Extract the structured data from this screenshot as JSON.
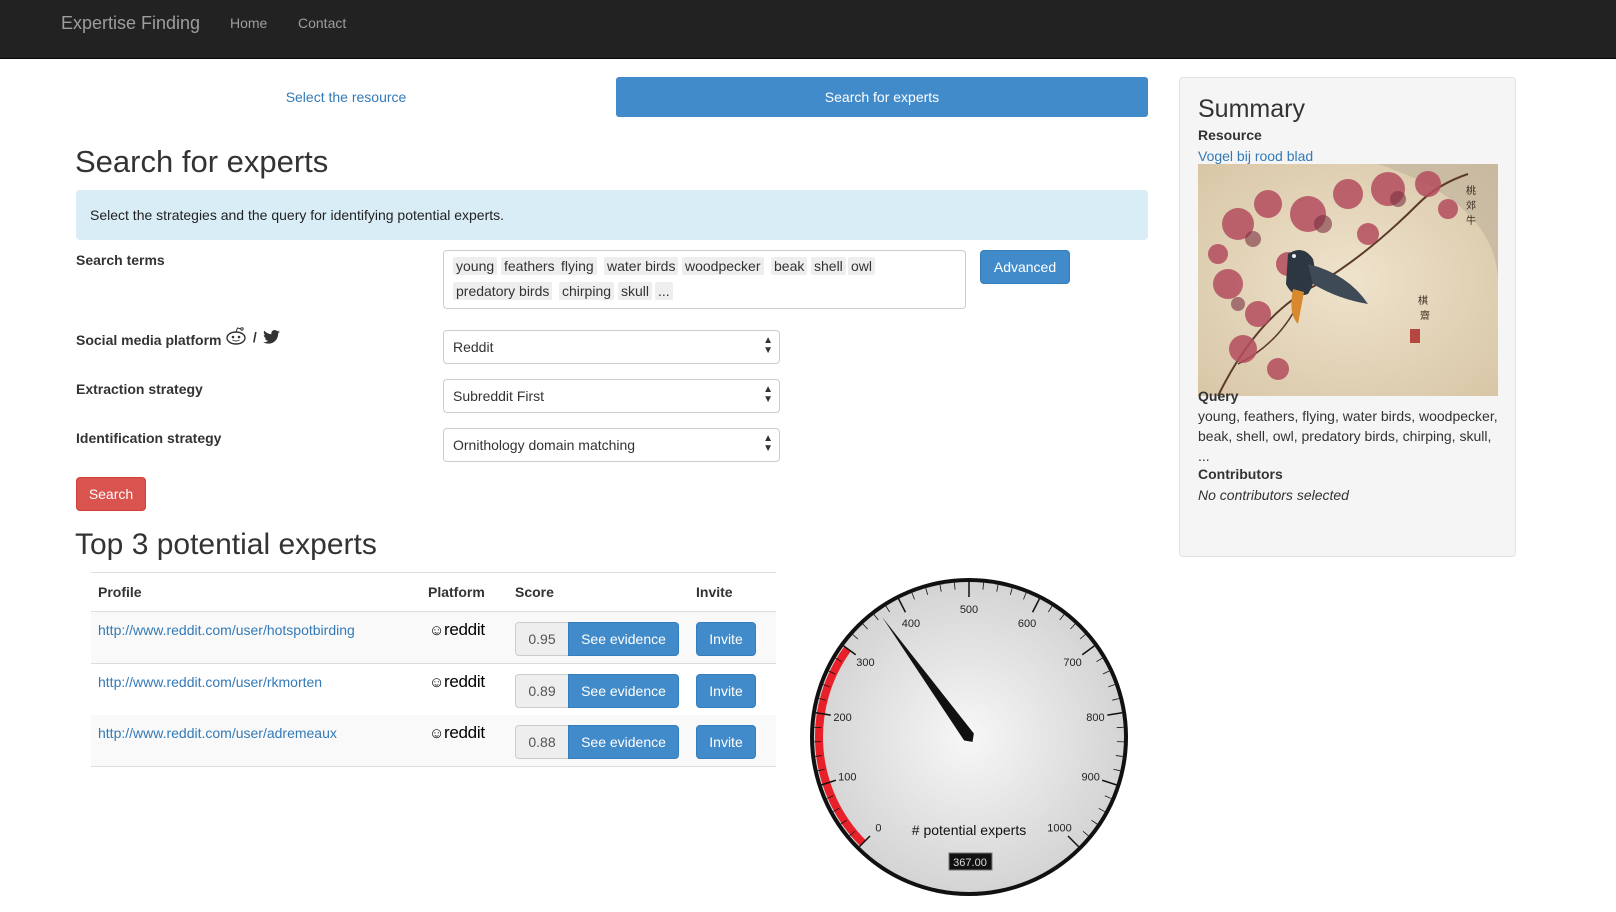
{
  "navbar": {
    "brand": "Expertise Finding",
    "links": [
      "Home",
      "Contact"
    ]
  },
  "steps": {
    "select_resource": "Select the resource",
    "search_experts": "Search for experts"
  },
  "main": {
    "title": "Search for experts",
    "info": "Select the strategies and the query for identifying potential experts."
  },
  "form": {
    "search_terms_label": "Search terms",
    "search_terms": [
      "young",
      "feathers",
      "flying",
      "water birds",
      "woodpecker",
      "beak",
      "shell",
      "owl",
      "predatory birds",
      "chirping",
      "skull",
      "..."
    ],
    "advanced_label": "Advanced",
    "platform_label": "Social media platform",
    "platform_separator": "/",
    "platform_value": "Reddit",
    "extraction_label": "Extraction strategy",
    "extraction_value": "Subreddit First",
    "identification_label": "Identification strategy",
    "identification_value": "Ornithology domain matching",
    "search_button": "Search"
  },
  "results": {
    "title": "Top 3 potential experts",
    "headers": {
      "profile": "Profile",
      "platform": "Platform",
      "score": "Score",
      "invite": "Invite"
    },
    "platform_name": "reddit",
    "evidence_label": "See evidence",
    "invite_label": "Invite",
    "rows": [
      {
        "profile": "http://www.reddit.com/user/hotspotbirding",
        "score": "0.95"
      },
      {
        "profile": "http://www.reddit.com/user/rkmorten",
        "score": "0.89"
      },
      {
        "profile": "http://www.reddit.com/user/adremeaux",
        "score": "0.88"
      }
    ]
  },
  "summary": {
    "title": "Summary",
    "resource_label": "Resource",
    "resource_link": "Vogel bij rood blad",
    "query_label": "Query",
    "query_text": "young, feathers, flying, water birds, woodpecker, beak, shell, owl, predatory birds, chirping, skull, ...",
    "contributors_label": "Contributors",
    "contributors_text": "No contributors selected"
  },
  "gauge": {
    "label": "# potential experts",
    "value": 367,
    "value_text": "367.00",
    "min": 0,
    "max": 1000,
    "ticks": [
      "0",
      "100",
      "200",
      "300",
      "400",
      "500",
      "600",
      "700",
      "800",
      "900",
      "1000"
    ],
    "red_zone": [
      0,
      300
    ],
    "red_color": "#e8202a"
  },
  "colors": {
    "primary": "#428bca",
    "danger": "#d9534f",
    "navbar": "#222222",
    "info": "#d9edf7"
  }
}
